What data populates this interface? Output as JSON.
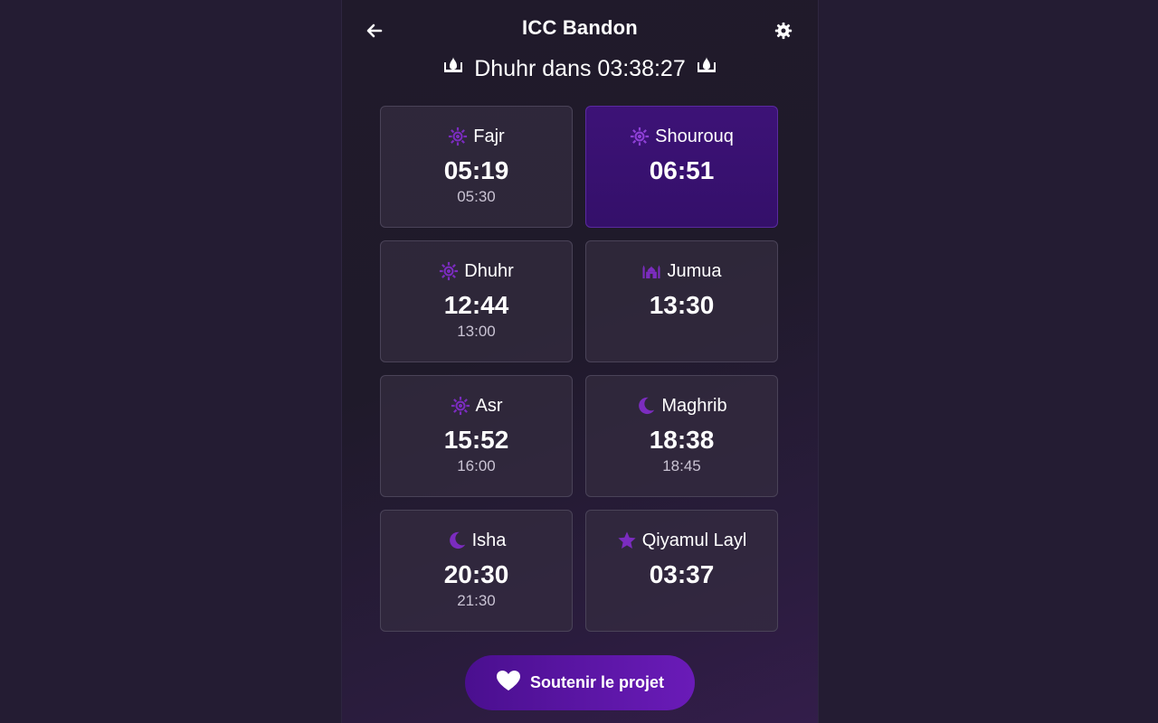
{
  "header": {
    "title": "ICC Bandon",
    "back_icon": "arrow-left-icon",
    "settings_icon": "gear-icon"
  },
  "countdown": {
    "text": "Dhuhr dans 03:38:27",
    "icon": "mosque-dome-icon"
  },
  "prayers": [
    {
      "name": "Fajr",
      "time": "05:19",
      "iqama": "05:30",
      "icon": "sun-icon",
      "active": false
    },
    {
      "name": "Shourouq",
      "time": "06:51",
      "iqama": "",
      "icon": "sun-icon",
      "active": true
    },
    {
      "name": "Dhuhr",
      "time": "12:44",
      "iqama": "13:00",
      "icon": "sun-icon",
      "active": false
    },
    {
      "name": "Jumua",
      "time": "13:30",
      "iqama": "",
      "icon": "mosque-icon",
      "active": false
    },
    {
      "name": "Asr",
      "time": "15:52",
      "iqama": "16:00",
      "icon": "sun-icon",
      "active": false
    },
    {
      "name": "Maghrib",
      "time": "18:38",
      "iqama": "18:45",
      "icon": "moon-icon",
      "active": false
    },
    {
      "name": "Isha",
      "time": "20:30",
      "iqama": "21:30",
      "icon": "moon-icon",
      "active": false
    },
    {
      "name": "Qiyamul Layl",
      "time": "03:37",
      "iqama": "",
      "icon": "star-icon",
      "active": false
    }
  ],
  "support": {
    "label": "Soutenir le projet",
    "icon": "heart-icon"
  },
  "colors": {
    "accent": "#7b2cbf",
    "active_card": "#3d1277",
    "background": "#241c33"
  }
}
